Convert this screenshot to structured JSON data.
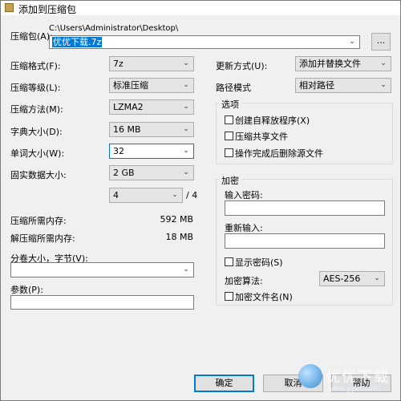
{
  "window": {
    "title": "添加到压缩包"
  },
  "archive": {
    "label": "压缩包(A):",
    "path": "C:\\Users\\Administrator\\Desktop\\",
    "filename": "优优下载.7z",
    "browse_label": "..."
  },
  "left": {
    "format": {
      "label": "压缩格式(F):",
      "value": "7z"
    },
    "level": {
      "label": "压缩等级(L):",
      "value": "标准压缩"
    },
    "method": {
      "label": "压缩方法(M):",
      "value": "LZMA2"
    },
    "dict": {
      "label": "字典大小(D):",
      "value": "16 MB"
    },
    "word": {
      "label": "单词大小(W):",
      "value": "32"
    },
    "solid": {
      "label": "固实数据大小:",
      "value": "2 GB"
    },
    "threads": {
      "value": "4",
      "max": "/ 4"
    },
    "mem_comp": {
      "label": "压缩所需内存:",
      "value": "592 MB"
    },
    "mem_decomp": {
      "label": "解压缩所需内存:",
      "value": "18 MB"
    },
    "split": {
      "label": "分卷大小，字节(V):",
      "value": ""
    },
    "params": {
      "label": "参数(P):",
      "value": ""
    }
  },
  "right": {
    "update": {
      "label": "更新方式(U):",
      "value": "添加并替换文件"
    },
    "path_mode": {
      "label": "路径模式",
      "value": "相对路径"
    },
    "options": {
      "title": "选项",
      "items": [
        {
          "label": "创建自释放程序(X)",
          "checked": false
        },
        {
          "label": "压缩共享文件",
          "checked": false
        },
        {
          "label": "操作完成后删除源文件",
          "checked": false
        }
      ]
    },
    "encryption": {
      "title": "加密",
      "password_label": "输入密码:",
      "reenter_label": "重新输入:",
      "show_password": "显示密码(S)",
      "method_label": "加密算法:",
      "method_value": "AES-256",
      "encrypt_names": "加密文件名(N)"
    }
  },
  "buttons": {
    "ok": "确定",
    "cancel": "取消",
    "help": "帮助"
  },
  "watermark": {
    "text": "优优下载",
    "url": "www.yyxt.com"
  }
}
